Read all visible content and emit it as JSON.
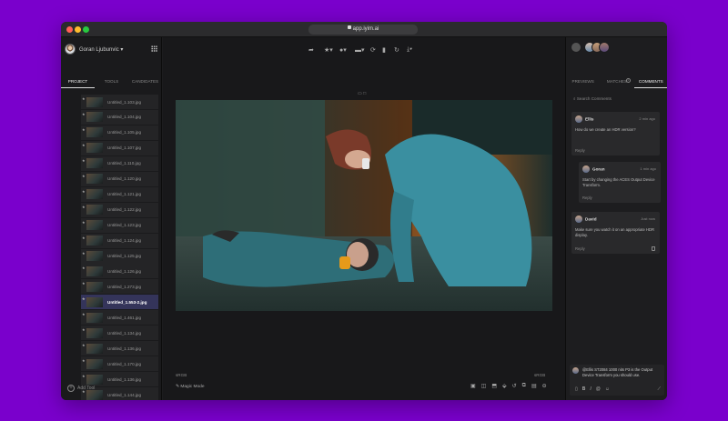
{
  "browser": {
    "url": "app.iyim.ai"
  },
  "user": {
    "name": "Goran Ljubunvic ▾"
  },
  "left_tabs": [
    "PROJECT",
    "TOOLS",
    "CANDIDATES"
  ],
  "files": [
    {
      "name": "Untitled_1.103.jpg"
    },
    {
      "name": "Untitled_1.104.jpg"
    },
    {
      "name": "Untitled_1.105.jpg"
    },
    {
      "name": "Untitled_1.107.jpg"
    },
    {
      "name": "Untitled_1.110.jpg"
    },
    {
      "name": "Untitled_1.120.jpg"
    },
    {
      "name": "Untitled_1.121.jpg"
    },
    {
      "name": "Untitled_1.122.jpg"
    },
    {
      "name": "Untitled_1.123.jpg"
    },
    {
      "name": "Untitled_1.124.jpg"
    },
    {
      "name": "Untitled_1.125.jpg"
    },
    {
      "name": "Untitled_1.126.jpg"
    },
    {
      "name": "Untitled_1.273.jpg"
    },
    {
      "name": "Untitled_1.553-2.jpg"
    },
    {
      "name": "Untitled_1.461.jpg"
    },
    {
      "name": "Untitled_1.134.jpg"
    },
    {
      "name": "Untitled_1.136.jpg"
    },
    {
      "name": "Untitled_1.170.jpg"
    },
    {
      "name": "Untitled_1.136.jpg"
    },
    {
      "name": "Untitled_1.144.jpg"
    },
    {
      "name": "Untitled_1.443.jpg"
    }
  ],
  "selected_file_index": 13,
  "add_tool": "Add Tool",
  "color_space_left": "sRGB",
  "color_space_right": "sRGB",
  "magic_mode": "Magic Mode",
  "right_tabs": [
    {
      "label": "PREVIEWS"
    },
    {
      "label": "MATCHES",
      "badge": "1"
    },
    {
      "label": "COMMENTS"
    }
  ],
  "search_placeholder": "Search Comments",
  "comments": [
    {
      "author": "Ellis",
      "time": "2 min ago",
      "text": "How do we create an HDR version?",
      "reply": "Reply"
    },
    {
      "author": "Goran",
      "time": "1 min ago",
      "text": "Start by changing the ACES Output Device Transform.",
      "reply": "Reply"
    },
    {
      "author": "David",
      "time": "Just now",
      "text": "Make sure you watch it on an appropriate HDR display.",
      "reply": "Reply"
    }
  ],
  "composer_text": "@Ellis ST2084 1000 nits P3 is the Output Device Transform you should use.",
  "colors": {
    "background": "#7a00cc",
    "panel": "#1c1c1e",
    "selected_row": "#34345a"
  }
}
